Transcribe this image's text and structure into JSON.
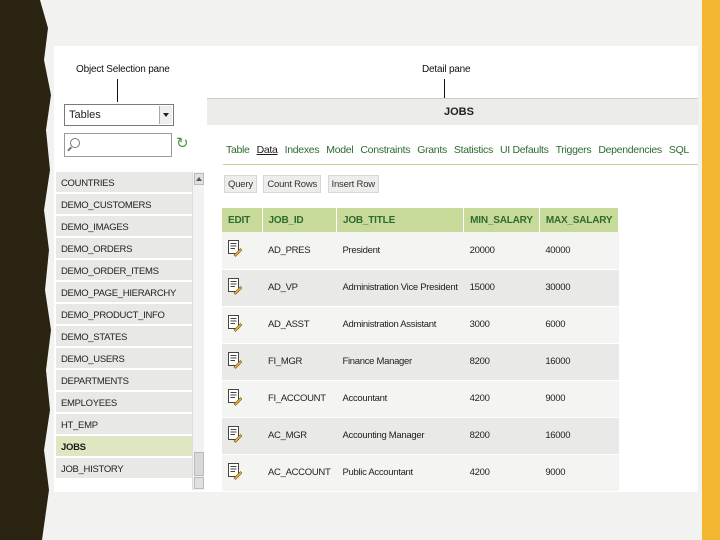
{
  "callouts": {
    "object_selection": "Object Selection pane",
    "detail": "Detail pane"
  },
  "left_pane": {
    "object_type": "Tables",
    "search_placeholder": "",
    "objects": [
      {
        "label": "COUNTRIES",
        "active": false
      },
      {
        "label": "DEMO_CUSTOMERS",
        "active": false
      },
      {
        "label": "DEMO_IMAGES",
        "active": false
      },
      {
        "label": "DEMO_ORDERS",
        "active": false
      },
      {
        "label": "DEMO_ORDER_ITEMS",
        "active": false
      },
      {
        "label": "DEMO_PAGE_HIERARCHY",
        "active": false
      },
      {
        "label": "DEMO_PRODUCT_INFO",
        "active": false
      },
      {
        "label": "DEMO_STATES",
        "active": false
      },
      {
        "label": "DEMO_USERS",
        "active": false
      },
      {
        "label": "DEPARTMENTS",
        "active": false
      },
      {
        "label": "EMPLOYEES",
        "active": false
      },
      {
        "label": "HT_EMP",
        "active": false
      },
      {
        "label": "JOBS",
        "active": true
      },
      {
        "label": "JOB_HISTORY",
        "active": false
      }
    ]
  },
  "detail": {
    "title": "JOBS",
    "tabs": [
      {
        "label": "Table",
        "active": false
      },
      {
        "label": "Data",
        "active": true
      },
      {
        "label": "Indexes",
        "active": false
      },
      {
        "label": "Model",
        "active": false
      },
      {
        "label": "Constraints",
        "active": false
      },
      {
        "label": "Grants",
        "active": false
      },
      {
        "label": "Statistics",
        "active": false
      },
      {
        "label": "UI Defaults",
        "active": false
      },
      {
        "label": "Triggers",
        "active": false
      },
      {
        "label": "Dependencies",
        "active": false
      },
      {
        "label": "SQL",
        "active": false
      }
    ],
    "buttons": {
      "query": "Query",
      "count_rows": "Count Rows",
      "insert_row": "Insert Row"
    },
    "columns": [
      "EDIT",
      "JOB_ID",
      "JOB_TITLE",
      "MIN_SALARY",
      "MAX_SALARY"
    ],
    "rows": [
      [
        "AD_PRES",
        "President",
        "20000",
        "40000"
      ],
      [
        "AD_VP",
        "Administration Vice President",
        "15000",
        "30000"
      ],
      [
        "AD_ASST",
        "Administration Assistant",
        "3000",
        "6000"
      ],
      [
        "FI_MGR",
        "Finance Manager",
        "8200",
        "16000"
      ],
      [
        "FI_ACCOUNT",
        "Accountant",
        "4200",
        "9000"
      ],
      [
        "AC_MGR",
        "Accounting Manager",
        "8200",
        "16000"
      ],
      [
        "AC_ACCOUNT",
        "Public Accountant",
        "4200",
        "9000"
      ]
    ]
  },
  "colors": {
    "accent_bar": "#f2b630",
    "left_decoration": "#2b2312",
    "table_header": "#c8da9a",
    "link_green": "#2e6b2e"
  }
}
